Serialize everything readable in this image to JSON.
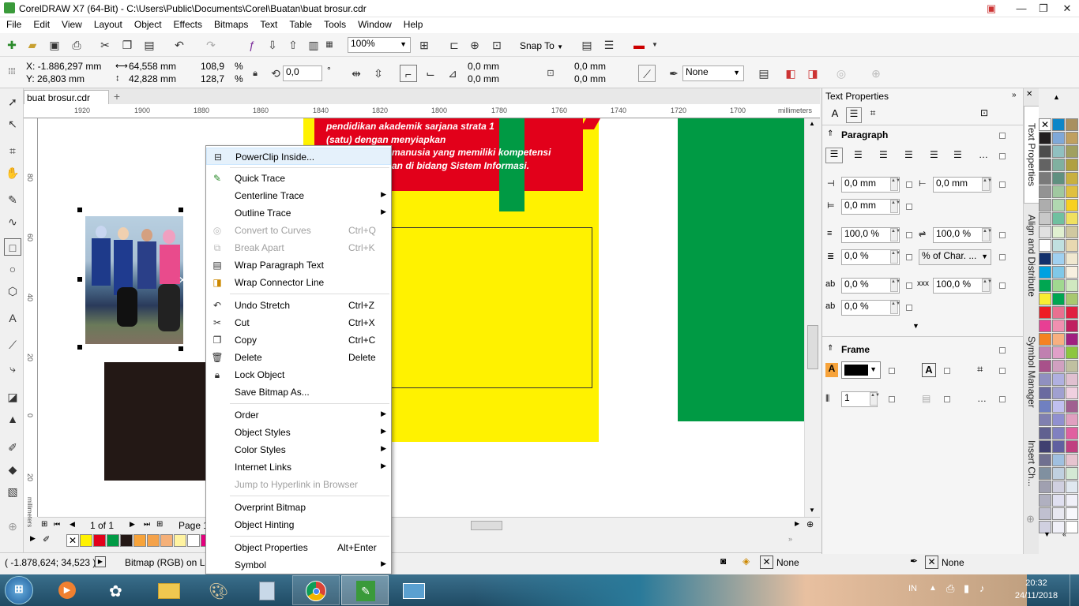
{
  "window": {
    "title": "CorelDRAW X7 (64-Bit) - C:\\Users\\Public\\Documents\\Corel\\Buatan\\buat brosur.cdr"
  },
  "menu": [
    "File",
    "Edit",
    "View",
    "Layout",
    "Object",
    "Effects",
    "Bitmaps",
    "Text",
    "Table",
    "Tools",
    "Window",
    "Help"
  ],
  "toolbar": {
    "zoom": "100%",
    "snap_to": "Snap To"
  },
  "propbar": {
    "x": "X: -1.886,297 mm",
    "y": "Y: 26,803 mm",
    "w": "64,558 mm",
    "h": "42,828 mm",
    "sx": "108,9",
    "sy": "128,7",
    "pct": "%",
    "angle": "0,0",
    "deg": "°",
    "c1": "0,0 mm",
    "c2": "0,0 mm",
    "c3": "0,0 mm",
    "c4": "0,0 mm",
    "outline": "None"
  },
  "doc_tab": "buat brosur.cdr",
  "ruler": {
    "unit": "millimeters",
    "h_ticks": [
      "1920",
      "1900",
      "1880",
      "1860",
      "1840",
      "1820",
      "1800",
      "1780",
      "1760",
      "1740",
      "1720",
      "1700"
    ],
    "v_ticks": [
      "80",
      "60",
      "40",
      "20",
      "0",
      "20",
      "40"
    ],
    "v_unit": "millimeters"
  },
  "canvas_text": {
    "line1": "pendidikan akademik sarjana strata 1",
    "line2": "(satu) dengan menyiapkan",
    "line3": "manusia yang memiliki kompetensi",
    "line4": "an di bidang Sistem Informasi."
  },
  "context_menu": [
    {
      "label": "PowerClip Inside...",
      "icon": "powerclip-icon",
      "highlighted": true
    },
    {
      "sep": true
    },
    {
      "label": "Quick Trace",
      "icon": "trace-icon"
    },
    {
      "label": "Centerline Trace",
      "sub": true
    },
    {
      "label": "Outline Trace",
      "sub": true
    },
    {
      "label": "Convert to Curves",
      "shortcut": "Ctrl+Q",
      "disabled": true,
      "icon": "curves-icon"
    },
    {
      "label": "Break Apart",
      "shortcut": "Ctrl+K",
      "disabled": true,
      "icon": "break-apart-icon"
    },
    {
      "label": "Wrap Paragraph Text",
      "icon": "wrap-text-icon"
    },
    {
      "label": "Wrap Connector Line",
      "icon": "wrap-connector-icon"
    },
    {
      "sep": true
    },
    {
      "label": "Undo Stretch",
      "shortcut": "Ctrl+Z",
      "icon": "undo-icon"
    },
    {
      "label": "Cut",
      "shortcut": "Ctrl+X",
      "icon": "cut-icon"
    },
    {
      "label": "Copy",
      "shortcut": "Ctrl+C",
      "icon": "copy-icon"
    },
    {
      "label": "Delete",
      "shortcut": "Delete",
      "icon": "delete-icon"
    },
    {
      "label": "Lock Object",
      "icon": "lock-icon"
    },
    {
      "label": "Save Bitmap As..."
    },
    {
      "sep": true
    },
    {
      "label": "Order",
      "sub": true
    },
    {
      "label": "Object Styles",
      "sub": true
    },
    {
      "label": "Color Styles",
      "sub": true
    },
    {
      "label": "Internet Links",
      "sub": true
    },
    {
      "label": "Jump to Hyperlink in Browser",
      "disabled": true
    },
    {
      "sep": true
    },
    {
      "label": "Overprint Bitmap"
    },
    {
      "label": "Object Hinting"
    },
    {
      "sep": true
    },
    {
      "label": "Object Properties",
      "shortcut": "Alt+Enter"
    },
    {
      "label": "Symbol",
      "sub": true
    }
  ],
  "pagebar": {
    "page_count": "1 of 1",
    "page_name": "Page 1"
  },
  "status": {
    "coords": "( -1.878,624; 34,523 )",
    "object": "Bitmap (RGB) on La",
    "fill_none": "None",
    "outline_none": "None"
  },
  "text_properties": {
    "title": "Text Properties",
    "paragraph": "Paragraph",
    "indent_left": "0,0 mm",
    "indent_right": "0,0 mm",
    "indent_first": "0,0 mm",
    "line_spacing": "100,0 %",
    "char_spacing": "100,0 %",
    "before": "0,0 %",
    "spacing_unit": "% of Char. ...",
    "word": "0,0 %",
    "word2": "100,0 %",
    "lang": "0,0 %",
    "frame": "Frame",
    "columns": "1"
  },
  "side_tabs": [
    "Text Properties",
    "Align and Distribute",
    "Symbol Manager",
    "Insert Ch..."
  ],
  "palette_colors": [
    "#ffffff",
    "#000000",
    "#ff0000",
    "#009a44",
    "#1a1a1a",
    "#f7a33a",
    "#f7a33a",
    "#f4a460",
    "#fff2a0",
    "#ffffff"
  ],
  "right_palette": [
    "#ffffff",
    "#0c86c8",
    "#1c9c43",
    "#231f20",
    "#4d4d4d",
    "#6c6c6c",
    "#898989",
    "#a6a6a6",
    "#c7c7c7",
    "#e1e1e1",
    "#ffffff",
    "#00a1e0",
    "#13306c",
    "#00a651",
    "#ed1c24",
    "#e83f94",
    "#f58220",
    "#f9ed32",
    "#8dc63f",
    "#a8518a",
    "#9090c0",
    "#6a6aa0",
    "#a0a0d0",
    "#404070",
    "#e6c3cf",
    "#d4e8d4"
  ],
  "taskbar": {
    "time": "20:32",
    "date": "24/11/2018",
    "lang": "IN"
  }
}
